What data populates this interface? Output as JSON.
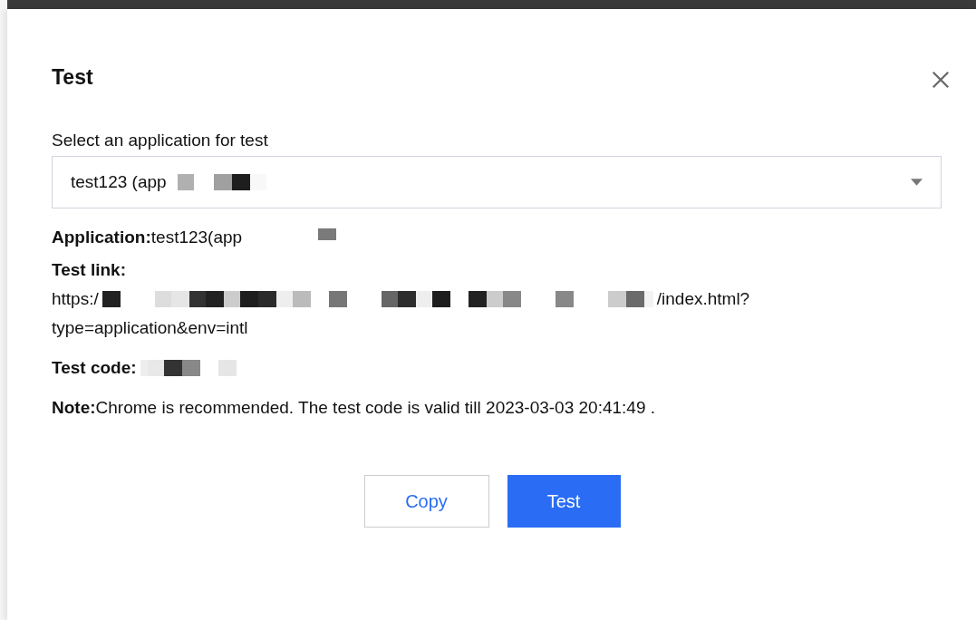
{
  "dialog": {
    "title": "Test",
    "select": {
      "label": "Select an application for test",
      "value": "test123 (app"
    },
    "application": {
      "label": "Application:",
      "value": "test123(app"
    },
    "test_link": {
      "label": "Test link:",
      "start": "https:/",
      "end": "/index.html?",
      "line_2": "type=application&env=intl"
    },
    "test_code": {
      "label": "Test code:"
    },
    "note": {
      "label": "Note:",
      "text": "Chrome is recommended. The test code is valid till 2023-03-03 20:41:49 ."
    },
    "buttons": [
      {
        "label": "Copy",
        "kind": "secondary"
      },
      {
        "label": "Test",
        "kind": "primary"
      }
    ]
  }
}
